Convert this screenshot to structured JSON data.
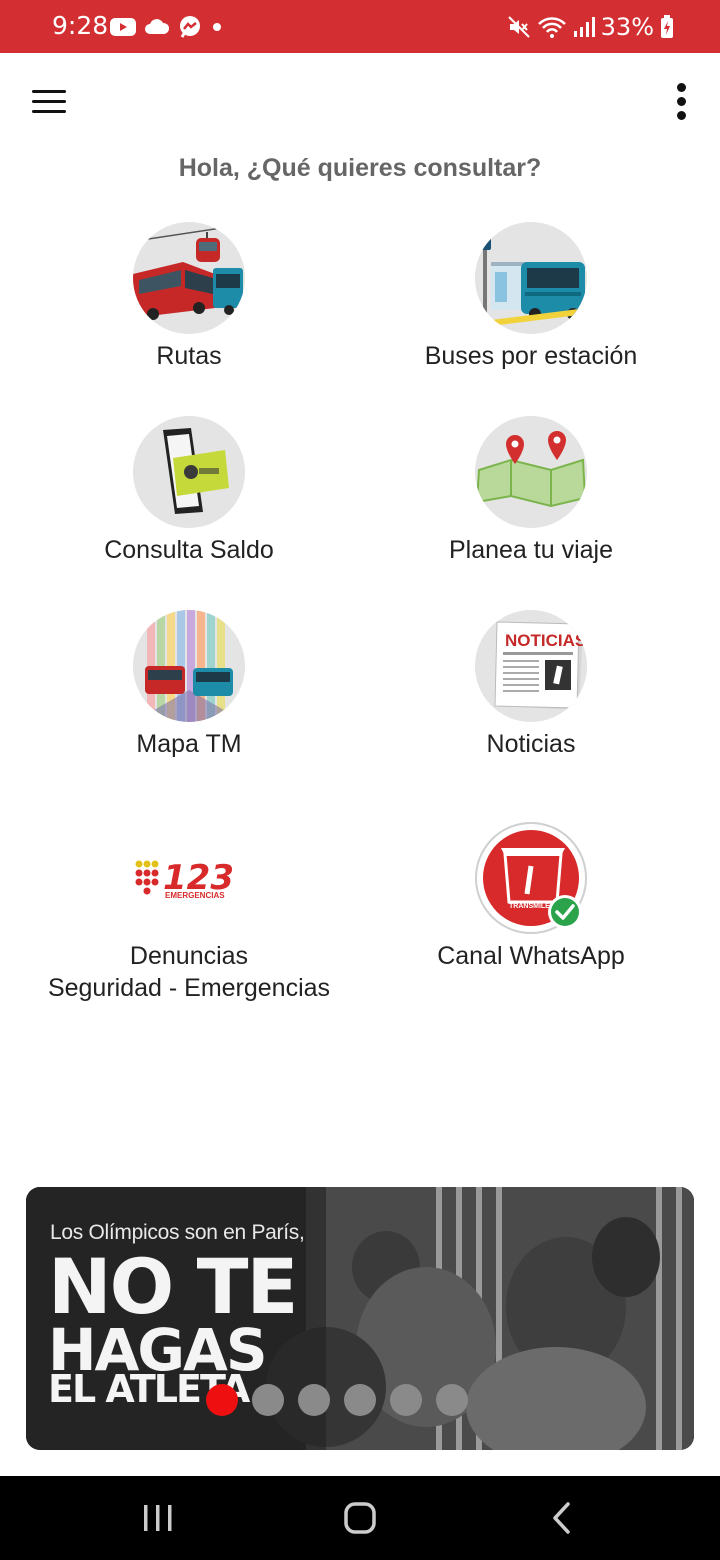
{
  "status_bar": {
    "time": "9:28",
    "battery": "33%",
    "left_icons": [
      "youtube-icon",
      "cloud-icon",
      "messenger-icon",
      "dot-icon"
    ],
    "right_icons": [
      "mute-icon",
      "wifi-icon",
      "signal-icon",
      "battery-charging-icon"
    ],
    "background": "#d32f32"
  },
  "app_bar": {
    "menu_icon": "hamburger-menu-icon",
    "more_icon": "more-vertical-icon"
  },
  "greeting": "Hola, ¿Qué quieres consultar?",
  "tiles": [
    {
      "label": "Rutas",
      "icon": "bus-cablecar-icon"
    },
    {
      "label": "Buses por estación",
      "icon": "bus-station-icon"
    },
    {
      "label": "Consulta Saldo",
      "icon": "phone-card-icon"
    },
    {
      "label": "Planea tu viaje",
      "icon": "map-pins-icon"
    },
    {
      "label": "Mapa TM",
      "icon": "colorful-route-map-icon"
    },
    {
      "label": "Noticias",
      "icon": "newspaper-icon"
    },
    {
      "label_line1": "Denuncias",
      "label_line2": "Seguridad - Emergencias",
      "icon": "emergency-123-icon",
      "logo_text": "123",
      "logo_subtext": "EMERGENCIAS"
    },
    {
      "label": "Canal WhatsApp",
      "icon": "transmilenio-whatsapp-icon",
      "logo_text": "TRANSMILENIO"
    }
  ],
  "tile_icon_texts": {
    "noticias": "NOTICIAS"
  },
  "banner": {
    "subtitle": "Los Olímpicos son en París,",
    "headline_1": "NO TE",
    "headline_2": "HAGAS",
    "headline_3": "EL ATLETA",
    "pages": 6,
    "active_page": 1,
    "active_dot_color": "#ee1010"
  },
  "nav_bar": {
    "buttons": [
      "recent-apps-icon",
      "home-icon",
      "back-icon"
    ]
  }
}
